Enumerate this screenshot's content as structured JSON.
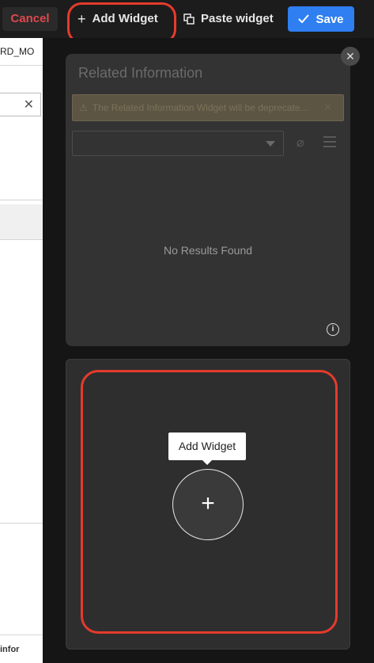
{
  "toolbar": {
    "cancel_label": "Cancel",
    "add_widget_label": "Add Widget",
    "paste_widget_label": "Paste widget",
    "save_label": "Save"
  },
  "left_panel": {
    "partial_text": "RD_MO",
    "footer_logo": "infor"
  },
  "related_card": {
    "title": "Related Information",
    "warning_text": "The Related Information Widget will be deprecate...",
    "empty_text": "No Results Found"
  },
  "add_card": {
    "tooltip": "Add Widget"
  },
  "colors": {
    "accent_blue": "#2f7ff1",
    "cancel_red": "#e0474c",
    "highlight_red": "#e53b2c"
  }
}
